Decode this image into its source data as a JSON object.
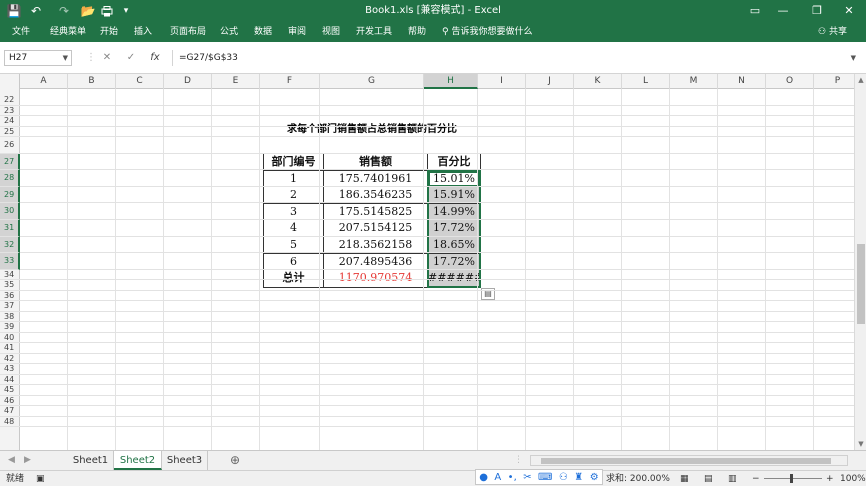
{
  "window": {
    "title": "Book1.xls  [兼容模式]  -  Excel",
    "minimize": "—",
    "restore": "❐",
    "close": "✕",
    "ribbon_display": "▭"
  },
  "quick_access": {
    "save_icon": "💾",
    "undo_icon": "↶",
    "redo_icon": "↷",
    "open_icon": "📂",
    "more_icon": "▾"
  },
  "ribbon": {
    "tabs": [
      "文件",
      "经典菜单",
      "开始",
      "插入",
      "页面布局",
      "公式",
      "数据",
      "审阅",
      "视图",
      "开发工具",
      "帮助"
    ],
    "tell_me": "告诉我你想要做什么",
    "share": "共享"
  },
  "formula_bar": {
    "name_box": "H27",
    "cancel_icon": "✕",
    "enter_icon": "✓",
    "fx_icon": "fx",
    "formula": "=G27/$G$33"
  },
  "grid": {
    "columns": [
      "A",
      "B",
      "C",
      "D",
      "E",
      "F",
      "G",
      "H",
      "I",
      "J",
      "K",
      "L",
      "M",
      "N",
      "O",
      "P"
    ],
    "selected_column": "H",
    "rows": [
      "22",
      "23",
      "24",
      "25",
      "26",
      "27",
      "28",
      "29",
      "30",
      "31",
      "32",
      "33",
      "34",
      "35",
      "36",
      "37",
      "38",
      "39",
      "40",
      "41",
      "42",
      "43",
      "44",
      "45",
      "46",
      "47",
      "48"
    ],
    "selected_rows": [
      "27",
      "28",
      "29",
      "30",
      "31",
      "32",
      "33"
    ]
  },
  "table": {
    "title": "求每个部门销售额占总销售额的百分比",
    "headers": [
      "部门编号",
      "销售额",
      "百分比"
    ],
    "rows": [
      [
        "1",
        "175.7401961",
        "15.01%"
      ],
      [
        "2",
        "186.3546235",
        "15.91%"
      ],
      [
        "3",
        "175.5145825",
        "14.99%"
      ],
      [
        "4",
        "207.5154125",
        "17.72%"
      ],
      [
        "5",
        "218.3562158",
        "18.65%"
      ],
      [
        "6",
        "207.4895436",
        "17.72%"
      ]
    ],
    "total_label": "总计",
    "total_value": "1170.970574",
    "total_percent": "######"
  },
  "sheets": {
    "tabs": [
      "Sheet1",
      "Sheet2",
      "Sheet3"
    ],
    "active": "Sheet2",
    "add_icon": "⊕"
  },
  "status": {
    "ready": "就绪",
    "sum": "求和: 200.00%",
    "zoom": "100%"
  },
  "colors": {
    "accent": "#217346",
    "red_text": "#e53935"
  }
}
